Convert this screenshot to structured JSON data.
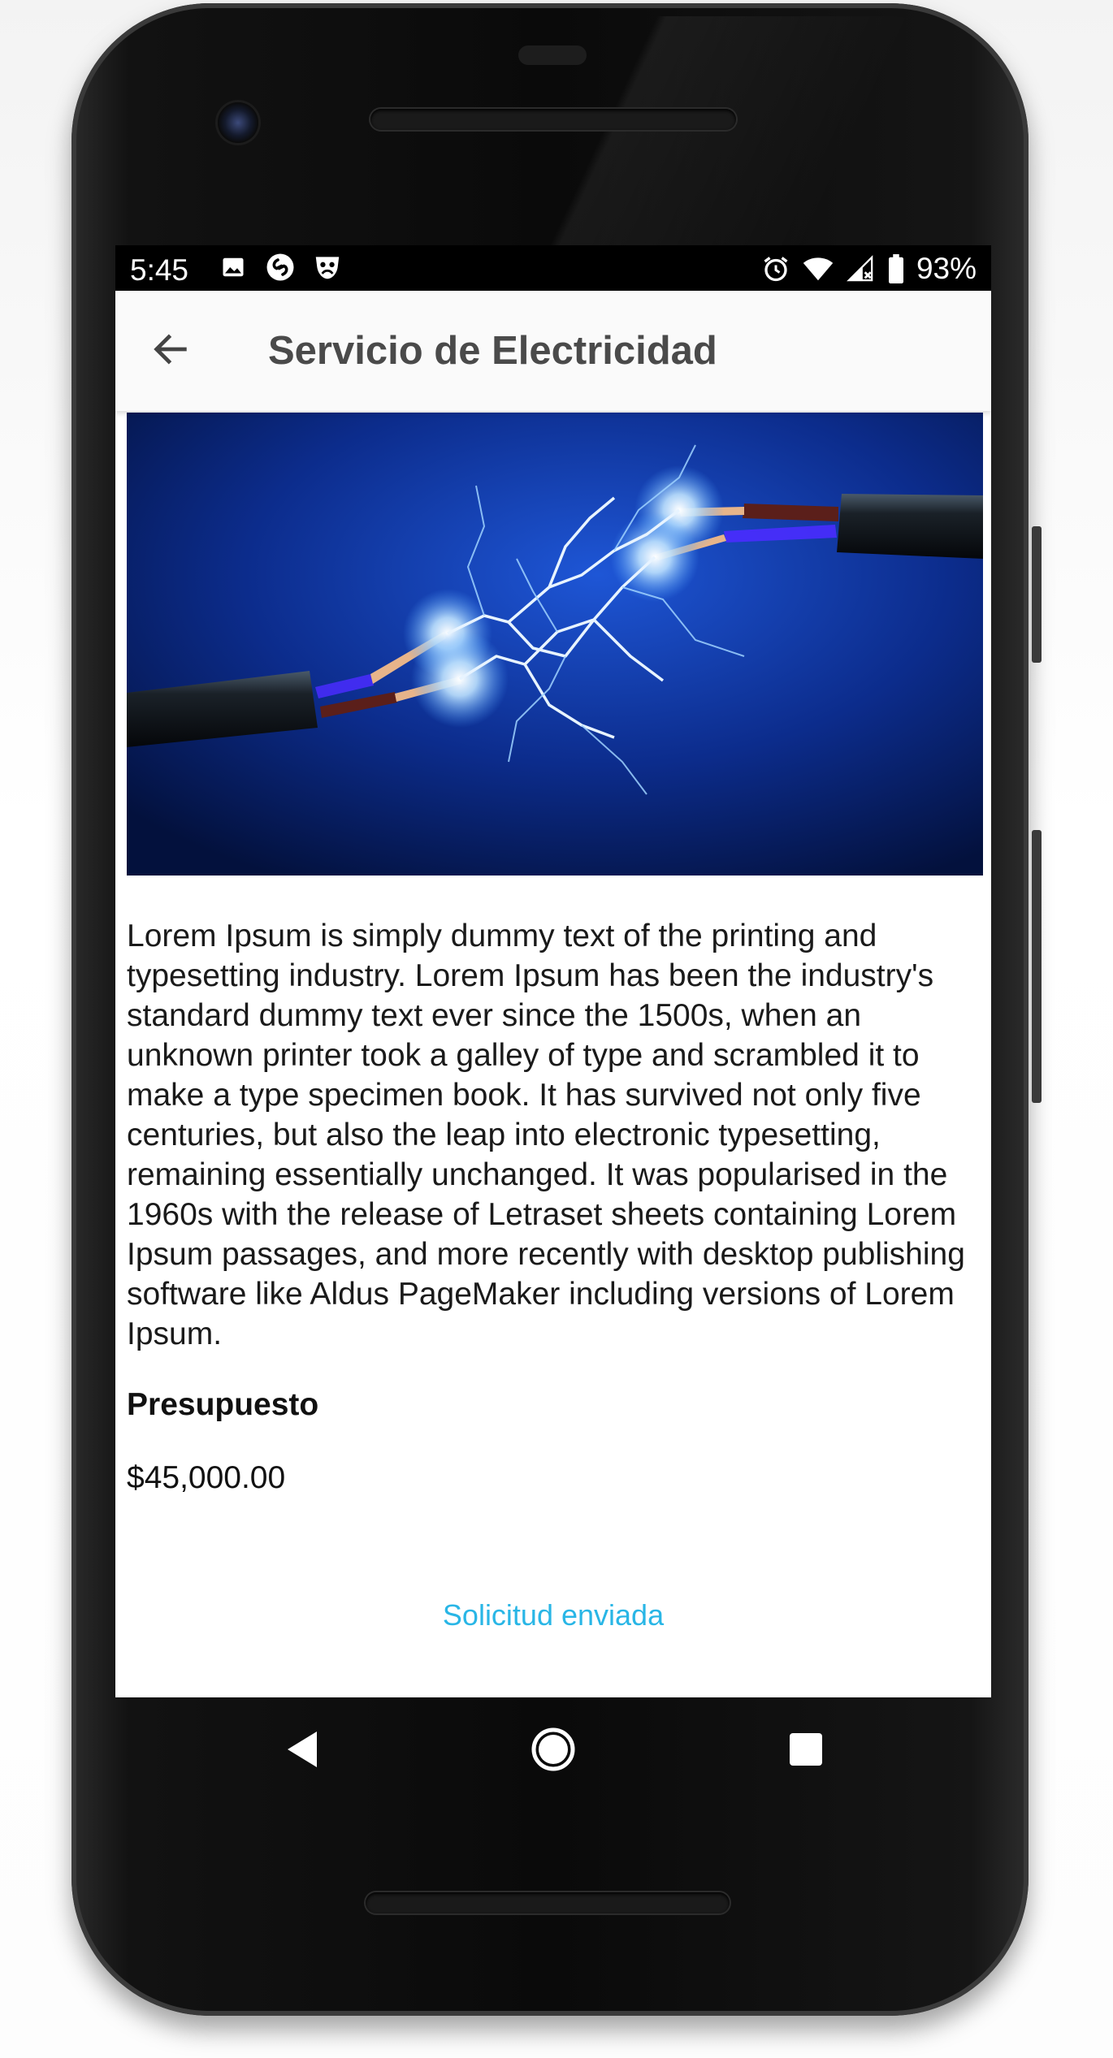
{
  "status_bar": {
    "time": "5:45",
    "left_icons": [
      "image-icon",
      "shazam-icon",
      "mask-icon"
    ],
    "right_icons": [
      "alarm-icon",
      "wifi-icon",
      "cell-signal-icon",
      "battery-icon"
    ],
    "battery": "93%"
  },
  "app_bar": {
    "back_icon": "arrow-back-icon",
    "title": "Servicio de Electricidad"
  },
  "hero_image": {
    "subject": "sparking electrical cables",
    "background_color": "#0c2c8c",
    "spark_color": "#bfe3ff"
  },
  "description": "Lorem Ipsum is simply dummy text of the printing and typesetting industry. Lorem Ipsum has been the industry's standard dummy text ever since the 1500s, when an unknown printer took a galley of type and scrambled it to make a type specimen book. It has survived not only five centuries, but also the leap into electronic typesetting, remaining essentially unchanged. It was popularised in the 1960s with the release of Letraset sheets containing Lorem Ipsum passages, and more recently with desktop publishing software like Aldus PageMaker including versions of Lorem Ipsum.",
  "budget": {
    "label": "Presupuesto",
    "value": "$45,000.00"
  },
  "action": {
    "label": "Solicitud enviada",
    "color": "#29b6e6"
  },
  "nav_bar": {
    "buttons": [
      "back-triangle-icon",
      "home-circle-icon",
      "recents-square-icon"
    ]
  }
}
